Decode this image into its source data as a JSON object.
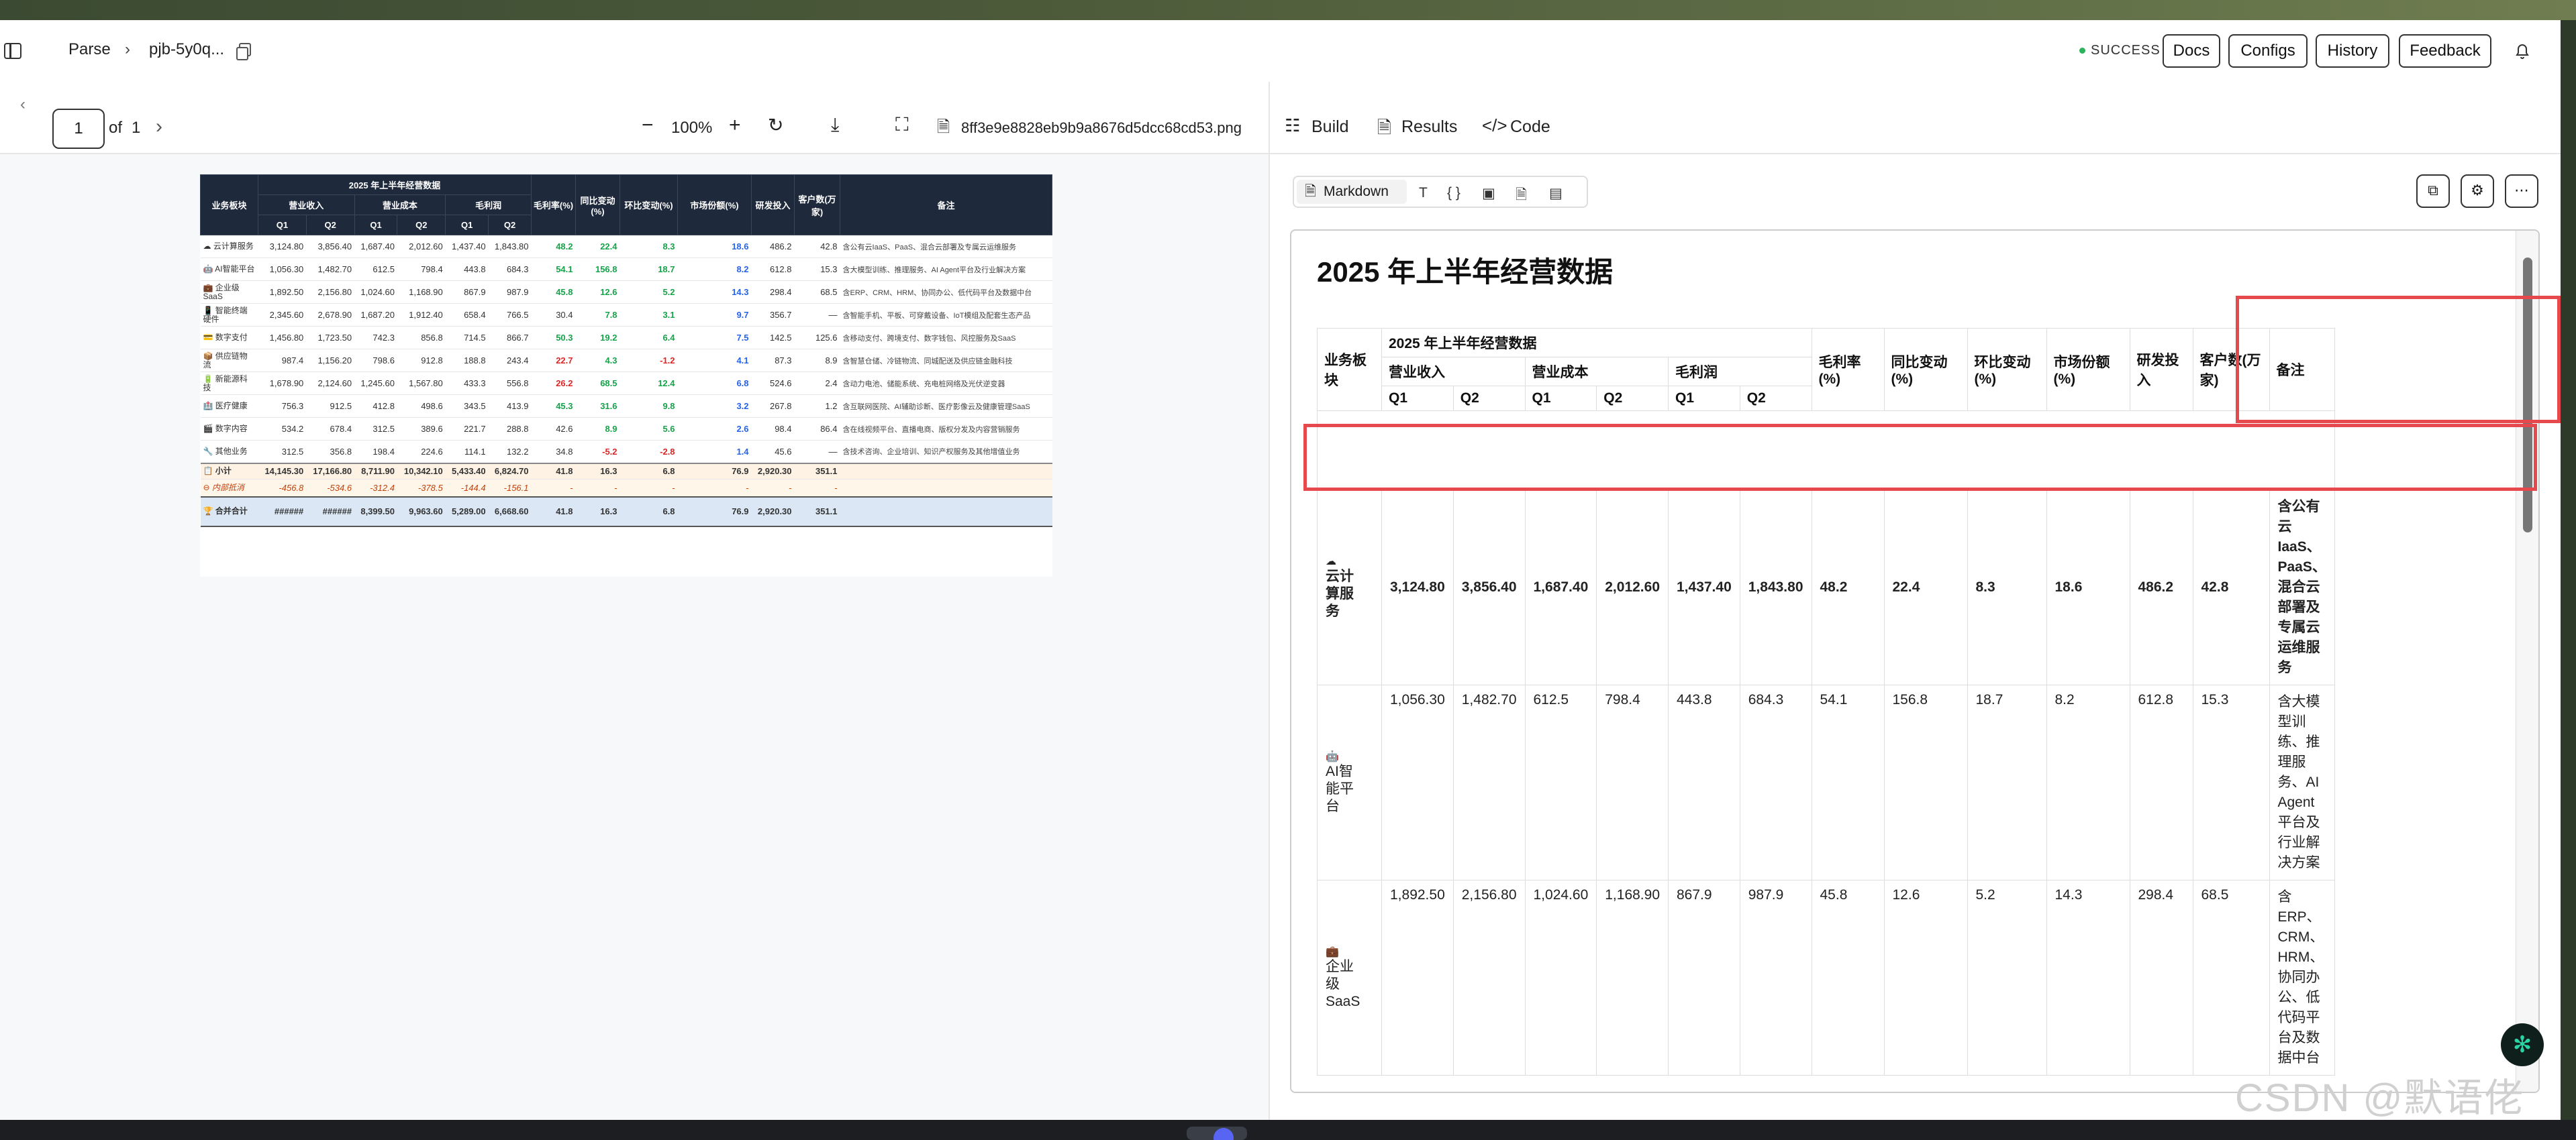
{
  "header": {
    "crumb": "Parse",
    "job_id": "pjb-5y0q...",
    "status": "SUCCESS",
    "buttons": [
      "Docs",
      "Configs",
      "History",
      "Feedback"
    ]
  },
  "viewer": {
    "page_current": "1",
    "page_of": "of",
    "page_total": "1",
    "zoom": "100%",
    "filename": "8ff3e9e8828eb9b9a8676d5dcc68cd53.png"
  },
  "right_tabs": [
    "Build",
    "Results",
    "Code"
  ],
  "format": {
    "label": "Markdown"
  },
  "doc": {
    "title": "2025 年上半年经营数据",
    "h_segment": "业务板块",
    "h_revenue": "营业收入",
    "h_cost": "营业成本",
    "h_gross": "毛利润",
    "q1": "Q1",
    "q2": "Q2",
    "h_margin": "毛利率(%)",
    "h_yoy": "同比变动(%)",
    "h_qoq": "环比变动(%)",
    "h_share": "市场份额(%)",
    "h_rd": "研发投入",
    "h_cust": "客户数(万家)",
    "h_note": "备注",
    "rows": [
      {
        "name": "☁ 云计算服务",
        "v": [
          "3,124.80",
          "3,856.40",
          "1,687.40",
          "2,012.60",
          "1,437.40",
          "1,843.80",
          "48.2",
          "22.4",
          "8.3",
          "18.6",
          "486.2",
          "42.8"
        ],
        "note": "含公有云IaaS、PaaS、混合云部署及专属云运维服务"
      },
      {
        "name": "🤖 AI智能平台",
        "v": [
          "1,056.30",
          "1,482.70",
          "612.5",
          "798.4",
          "443.8",
          "684.3",
          "54.1",
          "156.8",
          "18.7",
          "8.2",
          "612.8",
          "15.3"
        ],
        "note": "含大模型训练、推理服务、AI Agent平台及行业解决方案"
      },
      {
        "name": "💼 企业级SaaS",
        "v": [
          "1,892.50",
          "2,156.80",
          "1,024.60",
          "1,168.90",
          "867.9",
          "987.9",
          "45.8",
          "12.6",
          "5.2",
          "14.3",
          "298.4",
          "68.5"
        ],
        "note": "含ERP、CRM、HRM、协同办公、低代码平台及数据中台"
      },
      {
        "name": "📱 智能终端硬件",
        "v": [
          "2,345.60",
          "2,678.90",
          "1,687.20",
          "1,912.40",
          "658.4",
          "766.5",
          "30.4",
          "7.8",
          "3.1",
          "9.7",
          "356.7",
          "—"
        ],
        "note": "含智能手机、平板、可穿戴设备、IoT模组及配套生态产品"
      },
      {
        "name": "💳 数字支付",
        "v": [
          "1,456.80",
          "1,723.50",
          "742.3",
          "856.8",
          "714.5",
          "866.7",
          "50.3",
          "19.2",
          "6.4",
          "7.5",
          "142.5",
          "125.6"
        ],
        "note": "含移动支付、跨境支付、数字钱包、风控服务及SaaS"
      },
      {
        "name": "📦 供应链物流",
        "v": [
          "987.4",
          "1,156.20",
          "798.6",
          "912.8",
          "188.8",
          "243.4",
          "22.7",
          "4.3",
          "-1.2",
          "4.1",
          "87.3",
          "8.9"
        ],
        "note": "含智慧仓储、冷链物流、同城配送及供应链金融科技"
      },
      {
        "name": "🔋 新能源科技",
        "v": [
          "1,678.90",
          "2,124.60",
          "1,245.60",
          "1,567.80",
          "433.3",
          "556.8",
          "26.2",
          "68.5",
          "12.4",
          "6.8",
          "524.6",
          "2.4"
        ],
        "note": "含动力电池、储能系统、充电桩网络及光伏逆变器"
      },
      {
        "name": "🏥 医疗健康",
        "v": [
          "756.3",
          "912.5",
          "412.8",
          "498.6",
          "343.5",
          "413.9",
          "45.3",
          "31.6",
          "9.8",
          "3.2",
          "267.8",
          "1.2"
        ],
        "note": "含互联网医院、AI辅助诊断、医疗影像云及健康管理SaaS"
      },
      {
        "name": "🎬 数字内容",
        "v": [
          "534.2",
          "678.4",
          "312.5",
          "389.6",
          "221.7",
          "288.8",
          "42.6",
          "8.9",
          "5.6",
          "2.6",
          "98.4",
          "86.4"
        ],
        "note": "含在线视频平台、直播电商、版权分发及内容营销服务"
      },
      {
        "name": "🔧 其他业务",
        "v": [
          "312.5",
          "356.8",
          "198.4",
          "224.6",
          "114.1",
          "132.2",
          "34.8",
          "-5.2",
          "-2.8",
          "1.4",
          "45.6",
          "—"
        ],
        "note": "含技术咨询、企业培训、知识产权服务及其他增值业务"
      }
    ],
    "subtotal": {
      "name": "📋 小计",
      "v": [
        "14,145.30",
        "17,166.80",
        "8,711.90",
        "10,342.10",
        "5,433.40",
        "6,824.70",
        "41.8",
        "16.3",
        "6.8",
        "76.9",
        "2,920.30",
        "351.1"
      ]
    },
    "elim": {
      "name": "⊖ 内部抵消",
      "v": [
        "-456.8",
        "-534.6",
        "-312.4",
        "-378.5",
        "-144.4",
        "-156.1",
        "-",
        "-",
        "-",
        "-",
        "-",
        "-"
      ]
    },
    "total": {
      "name": "🏆 合并合计",
      "v": [
        "######",
        "######",
        "8,399.50",
        "9,963.60",
        "5,289.00",
        "6,668.60",
        "41.8",
        "16.3",
        "6.8",
        "76.9",
        "2,920.30",
        "351.1"
      ]
    }
  },
  "md": {
    "title": "2025 年上半年经营数据",
    "group": "2025 年上半年经营数据",
    "seg": "业务板块",
    "rev": "营业收入",
    "cost": "营业成本",
    "gross": "毛利润",
    "q1": "Q1",
    "q2": "Q2",
    "margin": "毛利率(%)",
    "yoy": "同比变动(%)",
    "qoq": "环比变动(%)",
    "share": "市场份额(%)",
    "rd": "研发投入",
    "cust": "客户数(万家)",
    "note": "备注",
    "rows": [
      {
        "icon": "☁",
        "name": "云计算服务",
        "v": [
          "3,124.80",
          "3,856.40",
          "1,687.40",
          "2,012.60",
          "1,437.40",
          "1,843.80",
          "48.2",
          "22.4",
          "8.3",
          "18.6",
          "486.2",
          "42.8"
        ],
        "note": "含公有云IaaS、PaaS、混合云部署及专属云运维服务"
      },
      {
        "icon": "🤖",
        "name": "AI智能平台",
        "v": [
          "1,056.30",
          "1,482.70",
          "612.5",
          "798.4",
          "443.8",
          "684.3",
          "54.1",
          "156.8",
          "18.7",
          "8.2",
          "612.8",
          "15.3"
        ],
        "note": "含大模型训练、推理服务、AI Agent平台及行业解决方案"
      },
      {
        "icon": "💼",
        "name": "企业级SaaS",
        "v": [
          "1,892.50",
          "2,156.80",
          "1,024.60",
          "1,168.90",
          "867.9",
          "987.9",
          "45.8",
          "12.6",
          "5.2",
          "14.3",
          "298.4",
          "68.5"
        ],
        "note": "含ERP、CRM、HRM、协同办公、低代码平台及数据中台"
      }
    ]
  },
  "watermark": "CSDN @默语佬",
  "colors": {
    "accent_red": "#e5484d",
    "success": "#2db35d",
    "doc_header": "#1e293b"
  }
}
